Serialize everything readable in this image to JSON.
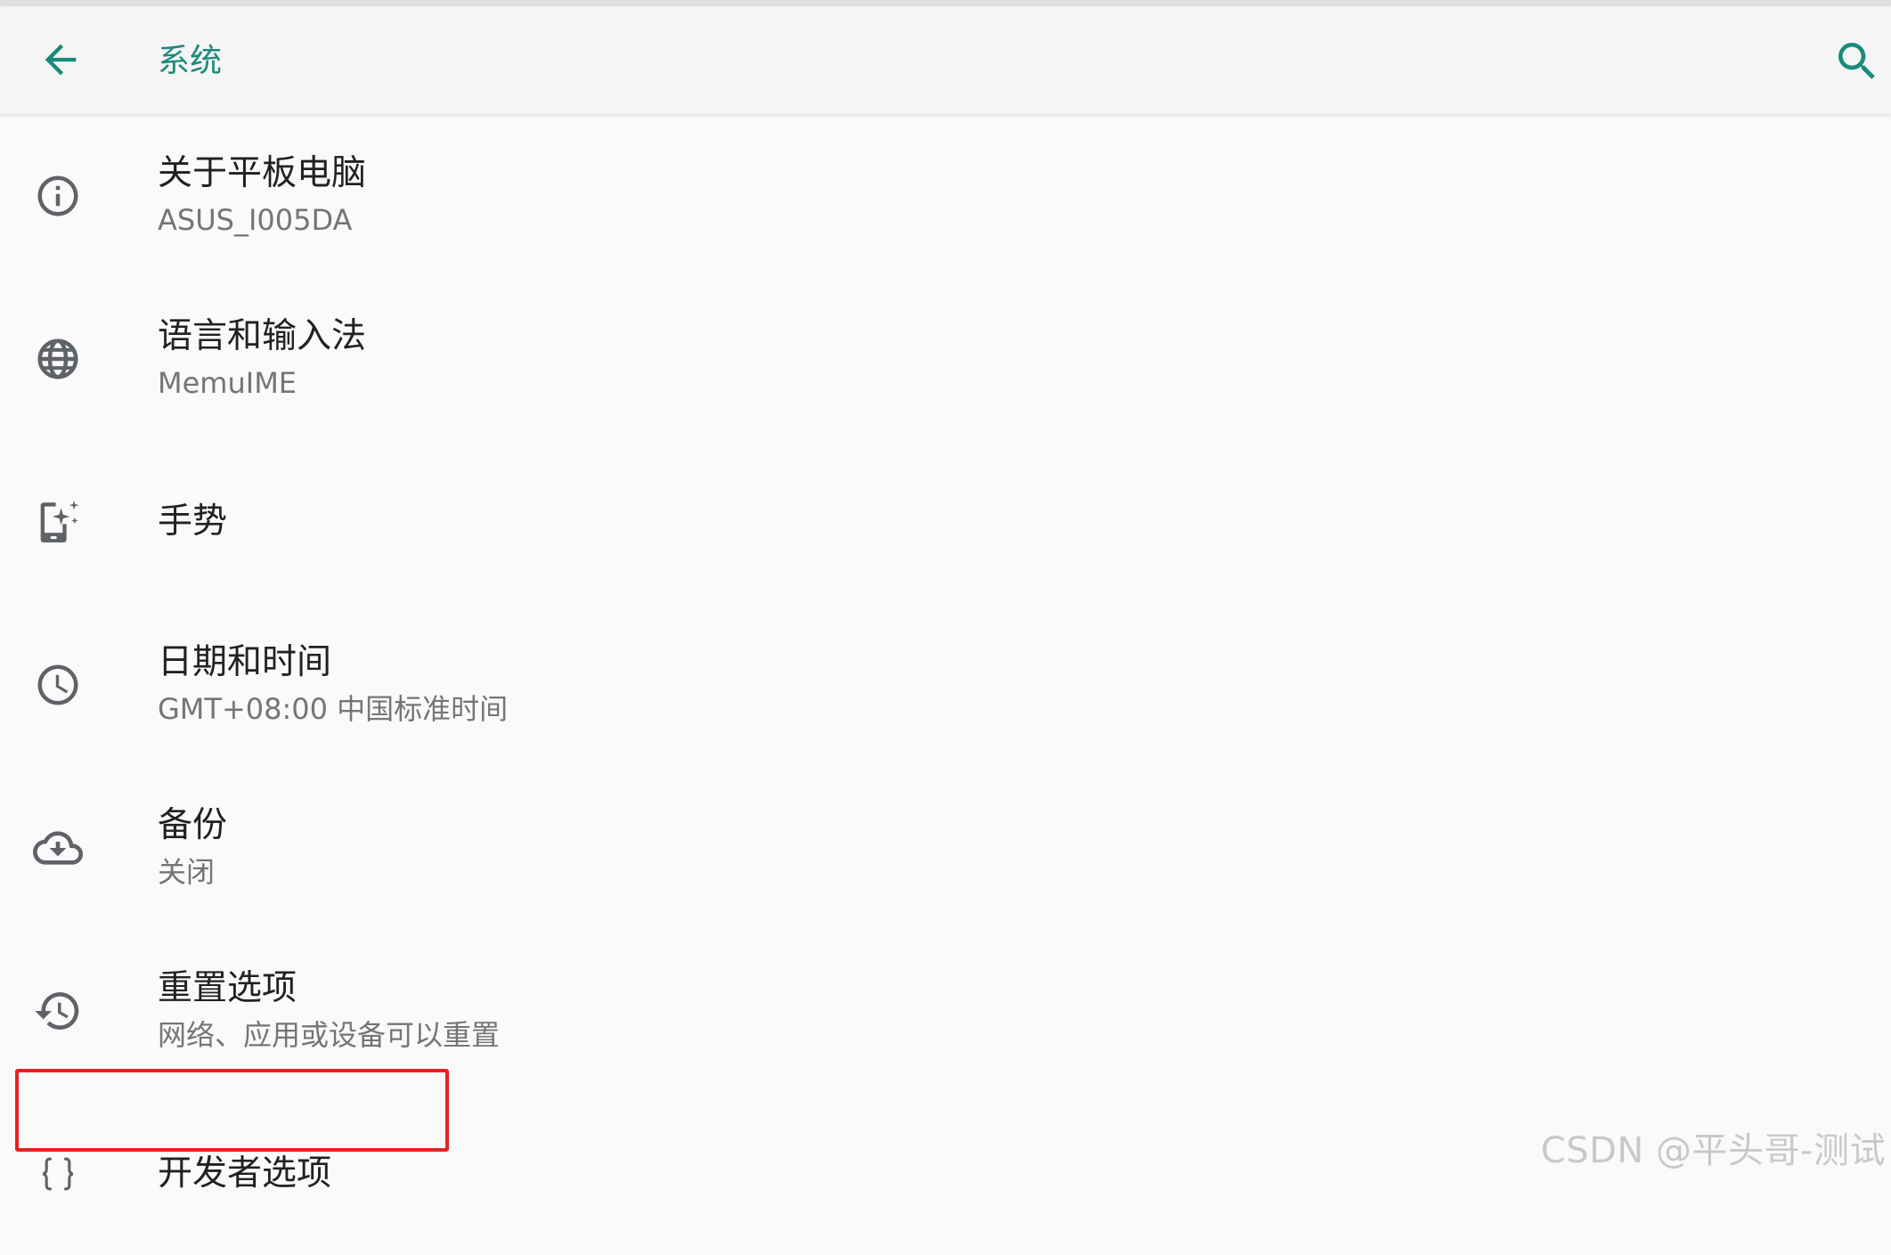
{
  "header": {
    "title": "系统",
    "back_icon": "arrow-left-icon",
    "search_icon": "search-icon"
  },
  "colors": {
    "accent": "#1a8a7a",
    "icon": "#5f6368",
    "title_text": "#212121",
    "subtitle_text": "#757575",
    "background": "#fafafa",
    "highlight": "#e52222"
  },
  "items": [
    {
      "id": "about-tablet",
      "icon": "info-icon",
      "title": "关于平板电脑",
      "subtitle": "ASUS_I005DA"
    },
    {
      "id": "language-input",
      "icon": "globe-icon",
      "title": "语言和输入法",
      "subtitle": "MemuIME"
    },
    {
      "id": "gestures",
      "icon": "phone-gesture-icon",
      "title": "手势",
      "subtitle": ""
    },
    {
      "id": "date-time",
      "icon": "clock-icon",
      "title": "日期和时间",
      "subtitle": "GMT+08:00 中国标准时间"
    },
    {
      "id": "backup",
      "icon": "cloud-backup-icon",
      "title": "备份",
      "subtitle": "关闭"
    },
    {
      "id": "reset-options",
      "icon": "history-icon",
      "title": "重置选项",
      "subtitle": "网络、应用或设备可以重置"
    },
    {
      "id": "developer-options",
      "icon": "code-braces-icon",
      "title": "开发者选项",
      "subtitle": ""
    }
  ],
  "watermark": "CSDN @平头哥-测试"
}
